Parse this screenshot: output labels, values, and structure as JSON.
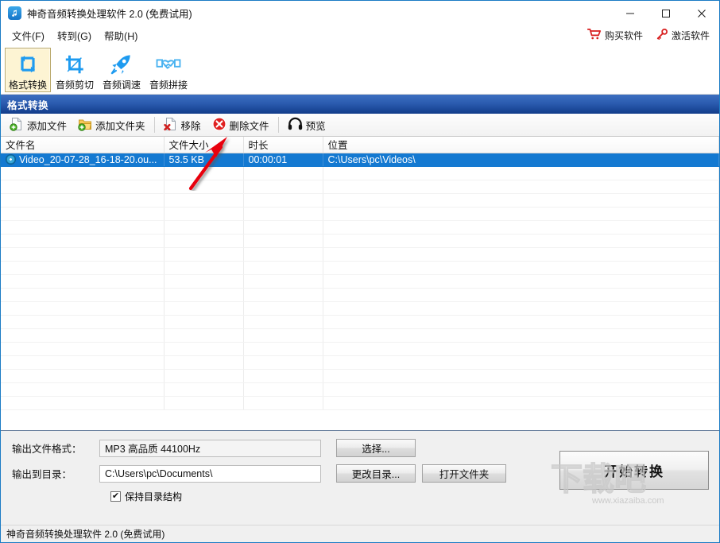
{
  "window": {
    "title": "神奇音频转换处理软件 2.0 (免费试用)",
    "icon": "music-note-icon",
    "controls": {
      "minimize": "—",
      "maximize": "☐",
      "close": "✕"
    },
    "accent_color": "#1479d1",
    "header_blue": "#123c8a"
  },
  "menubar": {
    "items": [
      {
        "label": "文件(F)",
        "name": "menu-file"
      },
      {
        "label": "转到(G)",
        "name": "menu-goto"
      },
      {
        "label": "帮助(H)",
        "name": "menu-help"
      }
    ],
    "right": [
      {
        "label": "购买软件",
        "icon": "cart-icon",
        "name": "buy-software"
      },
      {
        "label": "激活软件",
        "icon": "key-icon",
        "name": "activate-software"
      }
    ]
  },
  "modebar": {
    "items": [
      {
        "label": "格式转换",
        "icon": "convert-arrows-icon",
        "active": true
      },
      {
        "label": "音频剪切",
        "icon": "crop-icon",
        "active": false
      },
      {
        "label": "音频调速",
        "icon": "rocket-icon",
        "active": false
      },
      {
        "label": "音频拼接",
        "icon": "handshake-icon",
        "active": false
      }
    ]
  },
  "section": {
    "title": "格式转换"
  },
  "actionbar": {
    "items": [
      {
        "label": "添加文件",
        "icon": "file-add-icon"
      },
      {
        "label": "添加文件夹",
        "icon": "folder-add-icon"
      },
      {
        "label": "移除",
        "icon": "file-remove-icon"
      },
      {
        "label": "删除文件",
        "icon": "delete-circle-icon"
      },
      {
        "label": "预览",
        "icon": "headphones-icon"
      }
    ]
  },
  "filelist": {
    "columns": [
      "文件名",
      "文件大小",
      "时长",
      "位置"
    ],
    "rows": [
      {
        "icon": "media-disc-icon",
        "name": "Video_20-07-28_16-18-20.ou...",
        "size": "53.5 KB",
        "duration": "00:00:01",
        "location": "C:\\Users\\pc\\Videos\\",
        "selected": true
      }
    ]
  },
  "output": {
    "format_label": "输出文件格式：",
    "format_value": "MP3 高品质 44100Hz",
    "format_button": "选择...",
    "dir_label": "输出到目录：",
    "dir_value": "C:\\Users\\pc\\Documents\\",
    "dir_change_button": "更改目录...",
    "dir_open_button": "打开文件夹",
    "keep_structure_label": "保持目录结构",
    "keep_structure_checked": "✔",
    "start_button": "开始转换"
  },
  "statusbar": {
    "text": "神奇音频转换处理软件 2.0 (免费试用)"
  },
  "watermark": {
    "text": "下载吧",
    "url": "www.xiazaiba.com"
  }
}
